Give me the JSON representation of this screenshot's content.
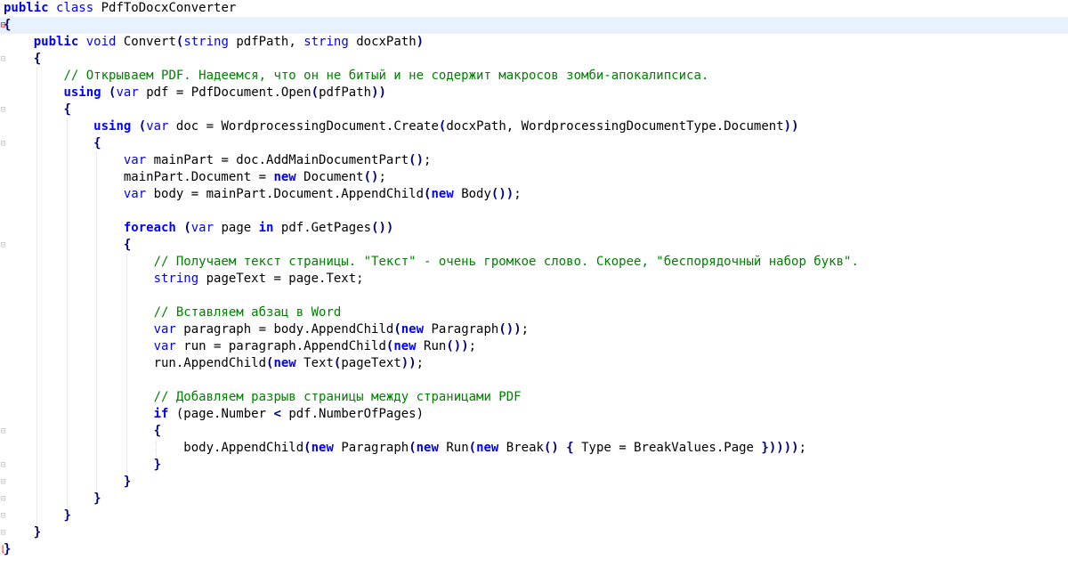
{
  "editor": {
    "colors": {
      "keyword": "#0000ff",
      "comment": "#008000",
      "type": "#0000a0",
      "highlight": "#e8f2fe"
    },
    "lines": [
      [
        {
          "t": "public",
          "c": "kw"
        },
        {
          "t": " class ",
          "c": "kw2"
        },
        {
          "t": "PdfToDocxConverter",
          "c": "id"
        }
      ],
      [
        {
          "t": "{",
          "c": "punc"
        }
      ],
      [
        {
          "t": "    "
        },
        {
          "t": "public",
          "c": "kw"
        },
        {
          "t": " void ",
          "c": "kw2"
        },
        {
          "t": "Convert",
          "c": "id"
        },
        {
          "t": "(",
          "c": "punc"
        },
        {
          "t": "string",
          "c": "kw2"
        },
        {
          "t": " pdfPath, ",
          "c": "id"
        },
        {
          "t": "string",
          "c": "kw2"
        },
        {
          "t": " docxPath",
          "c": "id"
        },
        {
          "t": ")",
          "c": "punc"
        }
      ],
      [
        {
          "t": "    "
        },
        {
          "t": "{",
          "c": "punc"
        }
      ],
      [
        {
          "t": "        "
        },
        {
          "t": "// Открываем PDF. Надеемся, что он не битый и не содержит макросов зомби-апокалипсиса.",
          "c": "cm"
        }
      ],
      [
        {
          "t": "        "
        },
        {
          "t": "using",
          "c": "kw"
        },
        {
          "t": " "
        },
        {
          "t": "(",
          "c": "punc"
        },
        {
          "t": "var",
          "c": "kw2"
        },
        {
          "t": " pdf = PdfDocument.Open",
          "c": "id"
        },
        {
          "t": "(",
          "c": "punc"
        },
        {
          "t": "pdfPath",
          "c": "id"
        },
        {
          "t": "))",
          "c": "punc"
        }
      ],
      [
        {
          "t": "        "
        },
        {
          "t": "{",
          "c": "punc"
        }
      ],
      [
        {
          "t": "            "
        },
        {
          "t": "using",
          "c": "kw"
        },
        {
          "t": " "
        },
        {
          "t": "(",
          "c": "punc"
        },
        {
          "t": "var",
          "c": "kw2"
        },
        {
          "t": " doc = WordprocessingDocument.Create",
          "c": "id"
        },
        {
          "t": "(",
          "c": "punc"
        },
        {
          "t": "docxPath, WordprocessingDocumentType.Document",
          "c": "id"
        },
        {
          "t": "))",
          "c": "punc"
        }
      ],
      [
        {
          "t": "            "
        },
        {
          "t": "{",
          "c": "punc"
        }
      ],
      [
        {
          "t": "                "
        },
        {
          "t": "var",
          "c": "kw2"
        },
        {
          "t": " mainPart = doc.AddMainDocumentPart",
          "c": "id"
        },
        {
          "t": "()",
          "c": "punc"
        },
        {
          "t": ";",
          "c": "id"
        }
      ],
      [
        {
          "t": "                "
        },
        {
          "t": "mainPart.Document = ",
          "c": "id"
        },
        {
          "t": "new",
          "c": "kw"
        },
        {
          "t": " Document",
          "c": "id"
        },
        {
          "t": "()",
          "c": "punc"
        },
        {
          "t": ";",
          "c": "id"
        }
      ],
      [
        {
          "t": "                "
        },
        {
          "t": "var",
          "c": "kw2"
        },
        {
          "t": " body = mainPart.Document.AppendChild",
          "c": "id"
        },
        {
          "t": "(",
          "c": "punc"
        },
        {
          "t": "new",
          "c": "kw"
        },
        {
          "t": " Body",
          "c": "id"
        },
        {
          "t": "())",
          "c": "punc"
        },
        {
          "t": ";",
          "c": "id"
        }
      ],
      [],
      [
        {
          "t": "                "
        },
        {
          "t": "foreach",
          "c": "kw"
        },
        {
          "t": " "
        },
        {
          "t": "(",
          "c": "punc"
        },
        {
          "t": "var",
          "c": "kw2"
        },
        {
          "t": " page ",
          "c": "id"
        },
        {
          "t": "in",
          "c": "kw"
        },
        {
          "t": " pdf.GetPages",
          "c": "id"
        },
        {
          "t": "())",
          "c": "punc"
        }
      ],
      [
        {
          "t": "                "
        },
        {
          "t": "{",
          "c": "punc"
        }
      ],
      [
        {
          "t": "                    "
        },
        {
          "t": "// Получаем текст страницы. \"Текст\" - очень громкое слово. Скорее, \"беспорядочный набор букв\".",
          "c": "cm"
        }
      ],
      [
        {
          "t": "                    "
        },
        {
          "t": "string",
          "c": "kw2"
        },
        {
          "t": " pageText = page.Text;",
          "c": "id"
        }
      ],
      [],
      [
        {
          "t": "                    "
        },
        {
          "t": "// Вставляем абзац в Word",
          "c": "cm"
        }
      ],
      [
        {
          "t": "                    "
        },
        {
          "t": "var",
          "c": "kw2"
        },
        {
          "t": " paragraph = body.AppendChild",
          "c": "id"
        },
        {
          "t": "(",
          "c": "punc"
        },
        {
          "t": "new",
          "c": "kw"
        },
        {
          "t": " Paragraph",
          "c": "id"
        },
        {
          "t": "())",
          "c": "punc"
        },
        {
          "t": ";",
          "c": "id"
        }
      ],
      [
        {
          "t": "                    "
        },
        {
          "t": "var",
          "c": "kw2"
        },
        {
          "t": " run = paragraph.AppendChild",
          "c": "id"
        },
        {
          "t": "(",
          "c": "punc"
        },
        {
          "t": "new",
          "c": "kw"
        },
        {
          "t": " Run",
          "c": "id"
        },
        {
          "t": "())",
          "c": "punc"
        },
        {
          "t": ";",
          "c": "id"
        }
      ],
      [
        {
          "t": "                    "
        },
        {
          "t": "run.AppendChild",
          "c": "id"
        },
        {
          "t": "(",
          "c": "punc"
        },
        {
          "t": "new",
          "c": "kw"
        },
        {
          "t": " Text",
          "c": "id"
        },
        {
          "t": "(",
          "c": "punc"
        },
        {
          "t": "pageText",
          "c": "id"
        },
        {
          "t": "))",
          "c": "punc"
        },
        {
          "t": ";",
          "c": "id"
        }
      ],
      [],
      [
        {
          "t": "                    "
        },
        {
          "t": "// Добавляем разрыв страницы между страницами PDF",
          "c": "cm"
        }
      ],
      [
        {
          "t": "                    "
        },
        {
          "t": "if",
          "c": "kw"
        },
        {
          "t": " (page.Number ",
          "c": "id"
        },
        {
          "t": "<",
          "c": "punc"
        },
        {
          "t": " pdf.NumberOfPages)",
          "c": "id"
        }
      ],
      [
        {
          "t": "                    "
        },
        {
          "t": "{",
          "c": "punc"
        }
      ],
      [
        {
          "t": "                        "
        },
        {
          "t": "body.AppendChild",
          "c": "id"
        },
        {
          "t": "(",
          "c": "punc"
        },
        {
          "t": "new",
          "c": "kw"
        },
        {
          "t": " Paragraph",
          "c": "id"
        },
        {
          "t": "(",
          "c": "punc"
        },
        {
          "t": "new",
          "c": "kw"
        },
        {
          "t": " Run",
          "c": "id"
        },
        {
          "t": "(",
          "c": "punc"
        },
        {
          "t": "new",
          "c": "kw"
        },
        {
          "t": " Break",
          "c": "id"
        },
        {
          "t": "()",
          "c": "punc"
        },
        {
          "t": " "
        },
        {
          "t": "{",
          "c": "punc"
        },
        {
          "t": " Type = BreakValues.Page ",
          "c": "id"
        },
        {
          "t": "}))))",
          "c": "punc"
        },
        {
          "t": ";",
          "c": "id"
        }
      ],
      [
        {
          "t": "                    "
        },
        {
          "t": "}",
          "c": "punc"
        }
      ],
      [
        {
          "t": "                "
        },
        {
          "t": "}",
          "c": "punc"
        }
      ],
      [
        {
          "t": "            "
        },
        {
          "t": "}",
          "c": "punc"
        }
      ],
      [
        {
          "t": "        "
        },
        {
          "t": "}",
          "c": "punc"
        }
      ],
      [
        {
          "t": "    "
        },
        {
          "t": "}",
          "c": "punc"
        }
      ],
      [
        {
          "t": "}",
          "c": "punc"
        }
      ]
    ]
  }
}
